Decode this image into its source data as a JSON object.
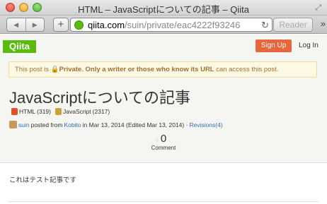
{
  "window": {
    "title": "HTML – JavaScriptについての記事 – Qiita"
  },
  "toolbar": {
    "back_icon": "◀",
    "forward_icon": "▶",
    "add_icon": "+",
    "url_host": "qiita.com",
    "url_path": "/suin/private/eac4222f93246",
    "reader_label": "Reader",
    "more_icon": "»"
  },
  "header": {
    "logo": "Qiita",
    "signup_label": "Sign Up",
    "login_label": "Log In"
  },
  "notice": {
    "prefix": "This post is ",
    "private_label": "Private. Only a writer or those who know its URL",
    "suffix": " can access this post."
  },
  "article": {
    "title": "JavaScriptについての記事",
    "tags": [
      {
        "label": "HTML",
        "count": "(319)"
      },
      {
        "label": "JavaScript",
        "count": "(2317)"
      }
    ],
    "author": "suin",
    "posted_from": " posted from ",
    "client": "Kobito",
    "date_text": " in Mar 13, 2014 (Edited Mar 13, 2014) · ",
    "revisions_label": "Revisions(4)",
    "comment_count": "0",
    "comment_label": "Comment",
    "body": "これはテスト記事です"
  },
  "colors": {
    "brand": "#59bb0c",
    "signup": "#e8663c",
    "link": "#2f6fb5",
    "notice_bg": "#fcf8e3"
  }
}
